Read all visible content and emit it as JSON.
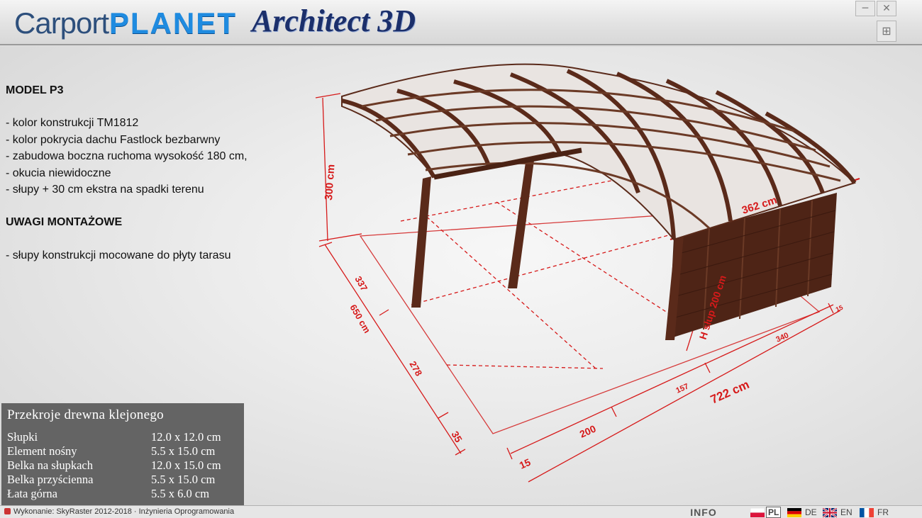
{
  "window": {
    "logo": {
      "part1": "Carport",
      "part2": "PLANET",
      "part3": "Architect 3D"
    },
    "buttons": {
      "minimize": "─",
      "close": "✕",
      "expand": "⊞"
    }
  },
  "description": {
    "model_title": "MODEL P3",
    "features": [
      "- kolor konstrukcji TM1812",
      "- kolor pokrycia dachu Fastlock bezbarwny",
      "- zabudowa boczna ruchoma wysokość 180 cm,",
      "- okucia niewidoczne",
      "- słupy + 30 cm ekstra na spadki terenu"
    ],
    "notes_title": "UWAGI MONTAŻOWE",
    "notes": [
      "- słupy konstrukcji mocowane do płyty tarasu"
    ]
  },
  "wood_sections": {
    "title": "Przekroje drewna klejonego",
    "rows": [
      {
        "label": "Słupki",
        "value": "12.0 x 12.0 cm"
      },
      {
        "label": "Element nośny",
        "value": "5.5 x 15.0 cm"
      },
      {
        "label": "Belka na słupkach",
        "value": "12.0 x 15.0 cm"
      },
      {
        "label": "Belka przyścienna",
        "value": "5.5 x 15.0 cm"
      },
      {
        "label": "Łata górna",
        "value": "5.5 x 6.0 cm"
      }
    ]
  },
  "dimensions": {
    "height": "300 cm",
    "roof_width": "362 cm",
    "post_height": "H słup 200 cm",
    "depth_total": "650 cm",
    "depth_seg1": "337",
    "depth_seg2": "278",
    "depth_seg3": "35",
    "length_total": "722 cm",
    "length_seg1": "200",
    "length_seg2": "157",
    "length_seg3": "340",
    "length_seg4": "15",
    "offset_small": "15"
  },
  "footer": {
    "credits": "Wykonanie: SkyRaster  2012-2018 · Inżynieria Oprogramowania",
    "info_label": "INFO",
    "languages": [
      {
        "code": "PL",
        "active": true
      },
      {
        "code": "DE",
        "active": false
      },
      {
        "code": "EN",
        "active": false
      },
      {
        "code": "FR",
        "active": false
      }
    ]
  },
  "colors": {
    "wood": "#5a2a1a",
    "dimension_line": "#d61a1a",
    "panel_bg": "#5a5a5a",
    "logo_blue": "#1f8be0",
    "logo_navy": "#1b2f6b"
  }
}
